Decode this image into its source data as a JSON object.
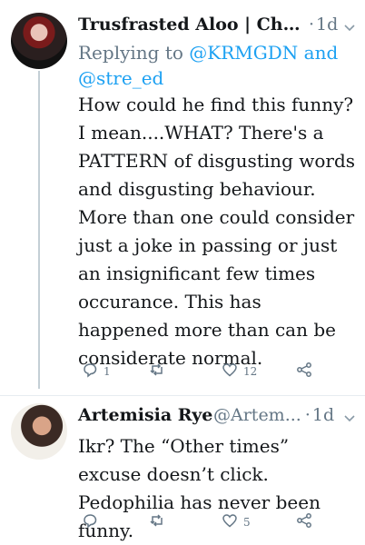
{
  "colors": {
    "accent": "#1da1f2",
    "muted": "#657786",
    "text": "#14171a"
  },
  "tweets": [
    {
      "author_name": "Trusfrasted Aloo | Che...",
      "handle": "",
      "dot": "·",
      "time": "1d",
      "reply_prefix": "Replying to",
      "mention1": "@KRMGDN",
      "reply_and": "and",
      "mention2": "@stre_ed",
      "text": "How could he find this funny? I mean....WHAT? There's a PATTERN of disgusting words and disgusting behaviour. More than one could consider just a joke in passing or just an insignificant few times occurance. This has happened more than can be considerate normal.",
      "replies": "1",
      "retweets": "",
      "likes": "12",
      "icons": [
        "reply-icon",
        "retweet-icon",
        "heart-icon",
        "share-icon",
        "chevron-down-icon"
      ]
    },
    {
      "author_name": "Artemisia Rye",
      "handle": "@Artem...",
      "dot": "·",
      "time": "1d",
      "text": "Ikr? The “Other times” excuse doesn’t click. Pedophilia has never been funny.",
      "replies": "",
      "retweets": "",
      "likes": "5",
      "icons": [
        "reply-icon",
        "retweet-icon",
        "heart-icon",
        "share-icon",
        "chevron-down-icon"
      ]
    }
  ]
}
